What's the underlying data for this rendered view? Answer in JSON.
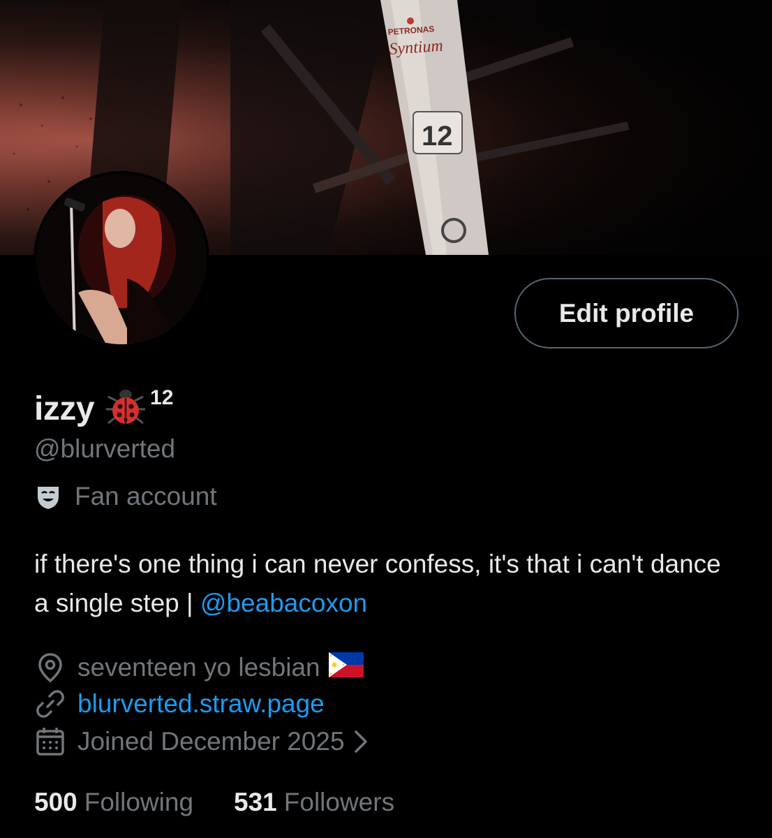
{
  "profile": {
    "display_name": "izzy",
    "label_number": "12",
    "handle": "@blurverted",
    "category": "Fan account",
    "bio_text": "if there's one thing i can never confess, it's that i can't dance a single step | ",
    "bio_mention": "@beabacoxon",
    "location": "seventeen yo lesbian",
    "website": "blurverted.straw.page",
    "joined": "Joined December 2025"
  },
  "actions": {
    "edit_profile_label": "Edit profile"
  },
  "stats": {
    "following_count": "500",
    "following_label": "Following",
    "followers_count": "531",
    "followers_label": "Followers"
  },
  "banner": {
    "sponsor_text": "PETRONAS",
    "brand_text": "Syntium",
    "car_number": "12"
  },
  "icons": {
    "category": "theater-mask-icon",
    "location": "location-pin-icon",
    "website": "link-icon",
    "joined": "calendar-icon",
    "emoji": "ladybug-icon",
    "flag": "philippines-flag-icon"
  },
  "colors": {
    "background": "#000000",
    "text_primary": "#e7e9ea",
    "text_secondary": "#71767b",
    "accent_link": "#1d9bf0",
    "button_border": "#536471"
  }
}
